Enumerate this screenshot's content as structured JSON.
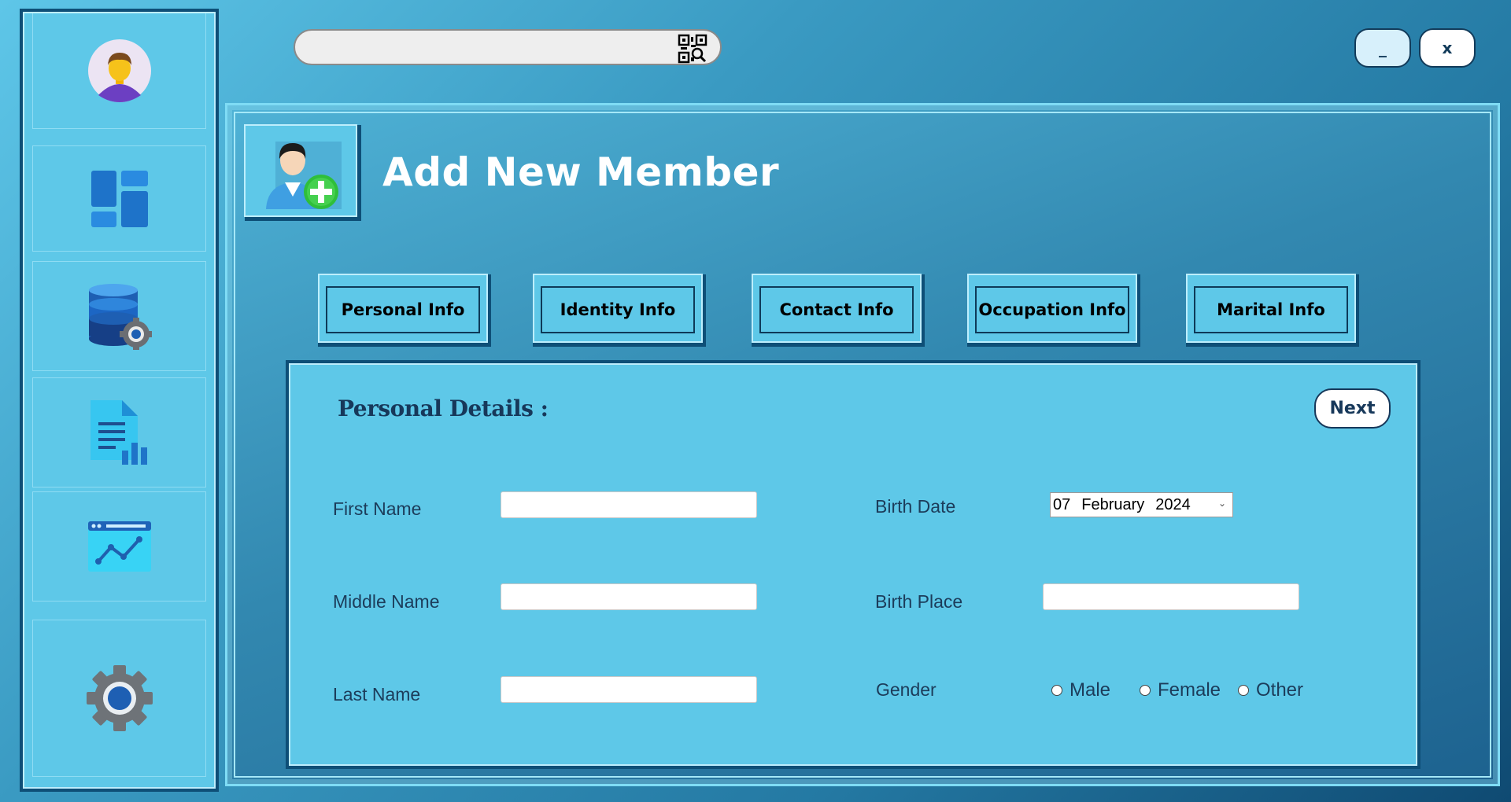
{
  "sidebar": {
    "items": [
      {
        "name": "profile",
        "icon": "user-avatar-icon"
      },
      {
        "name": "dashboard",
        "icon": "dashboard-icon"
      },
      {
        "name": "database",
        "icon": "database-settings-icon"
      },
      {
        "name": "reports",
        "icon": "report-document-icon"
      },
      {
        "name": "analytics",
        "icon": "analytics-chart-icon"
      },
      {
        "name": "settings",
        "icon": "gear-icon"
      }
    ]
  },
  "topbar": {
    "search_value": "",
    "qr_icon": "qr-scan-icon",
    "minimize_label": "_",
    "close_label": "x"
  },
  "header": {
    "title": "Add New Member",
    "icon": "add-user-icon"
  },
  "tabs": [
    {
      "label": "Personal Info"
    },
    {
      "label": "Identity Info"
    },
    {
      "label": "Contact Info"
    },
    {
      "label": "Occupation Info"
    },
    {
      "label": "Marital Info"
    }
  ],
  "form": {
    "section_title": "Personal Details :",
    "next_label": "Next",
    "first_name_label": "First Name",
    "middle_name_label": "Middle Name",
    "last_name_label": "Last Name",
    "birth_date_label": "Birth Date",
    "birth_place_label": "Birth Place",
    "gender_label": "Gender",
    "birth_date": {
      "day": "07",
      "month": "February",
      "year": "2024"
    },
    "first_name_value": "",
    "middle_name_value": "",
    "last_name_value": "",
    "birth_place_value": "",
    "gender_options": [
      "Male",
      "Female",
      "Other"
    ]
  },
  "colors": {
    "panel": "#5ec8e8",
    "border_dark": "#0e4f77",
    "text_dark": "#1c3c5a",
    "title_white": "#ffffff"
  }
}
